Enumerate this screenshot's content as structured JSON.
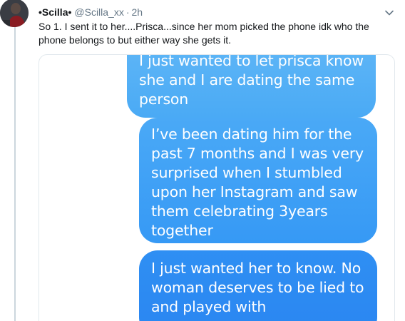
{
  "tweet": {
    "display_name": "•Scilla•",
    "handle": "@Scilla_xx",
    "separator": "·",
    "time": "2h",
    "text": "So 1. I sent it to her....Prisca...since her mom picked the phone idk who the phone belongs to but either way she gets it."
  },
  "media": {
    "messages": [
      {
        "lines": [
          "I just wanted to let prisca know",
          "she and I are dating the same",
          "person"
        ]
      },
      {
        "lines": [
          "I’ve been dating him for the",
          "past 7 months and I was very",
          "surprised when I stumbled",
          "upon her Instagram and saw",
          "them celebrating 3years",
          "together"
        ]
      },
      {
        "lines": [
          "I just wanted her to know. No",
          "woman deserves to be lied to",
          "and played with"
        ]
      }
    ]
  },
  "icons": {
    "menu": "chevron-down-icon",
    "avatar": "avatar"
  },
  "colors": {
    "thread_line": "#ccd6dd",
    "text_primary": "#14171a",
    "text_secondary": "#657786",
    "bubble_light": "#5fb6f6",
    "bubble_mid": "#3699f5",
    "bubble_dark": "#2a86f1"
  }
}
